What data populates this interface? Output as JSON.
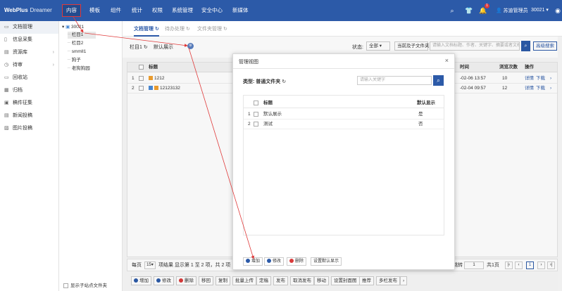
{
  "app": {
    "brand": "WebPlus",
    "brand_sub": "Dreamer"
  },
  "nav": {
    "items": [
      {
        "label": "内容",
        "active": true
      },
      {
        "label": "模板"
      },
      {
        "label": "组件"
      },
      {
        "label": "统计"
      },
      {
        "label": "权限"
      },
      {
        "label": "系统管理"
      },
      {
        "label": "安全中心"
      },
      {
        "label": "新媒体"
      }
    ],
    "notification_count": "1",
    "user": "苏迪管理员",
    "site": "30021"
  },
  "sidebar": {
    "items": [
      {
        "label": "文档管理",
        "icon": "folder-icon",
        "active": true
      },
      {
        "label": "信息采集",
        "icon": "file-icon"
      },
      {
        "label": "资源库",
        "icon": "database-icon",
        "arrow": true
      },
      {
        "label": "待审",
        "icon": "clock-icon",
        "arrow": true
      },
      {
        "label": "回收站",
        "icon": "trash-icon"
      },
      {
        "label": "归档",
        "icon": "archive-icon"
      },
      {
        "label": "稿件征集",
        "icon": "collect-icon"
      },
      {
        "label": "新闻投稿",
        "icon": "news-icon"
      },
      {
        "label": "图片投稿",
        "icon": "image-icon"
      }
    ]
  },
  "tree": {
    "root": "30021",
    "nodes": [
      "栏目1",
      "栏目2",
      "smmll1",
      "狗子",
      "老狗狗园"
    ],
    "footer": "显示子站点文件夹"
  },
  "tabs": [
    {
      "label": "文档管理",
      "active": true
    },
    {
      "label": "待办处理"
    },
    {
      "label": "文件夹管理"
    }
  ],
  "toolbar": {
    "crumb": "栏目1",
    "view_label": "默认展示",
    "status_label": "状态:",
    "status_value": "全部",
    "scope_value": "当前及子文件夹",
    "search_placeholder": "请输入文档标题、作者、关键字、摘要或者文档内容",
    "advanced_search": "高级搜索"
  },
  "grid": {
    "headers": {
      "title": "标题",
      "time": "时间",
      "views": "浏览次数",
      "ops": "操作"
    },
    "rows": [
      {
        "no": "1",
        "title": "1212",
        "time": "-02-06 13:57",
        "views": "10",
        "op1": "详情",
        "op2": "下载"
      },
      {
        "no": "2",
        "title": "12123132",
        "time": "-02-04 09:57",
        "views": "12",
        "op1": "详情",
        "op2": "下载"
      }
    ]
  },
  "pager": {
    "per_page_label": "每页",
    "per_page_value": "15",
    "summary": "项结果 显示第 1 至 2 项，共 2 项",
    "goto_label": "跳转",
    "goto_value": "1",
    "total_pages": "共1页",
    "current_page": "1"
  },
  "actions": [
    {
      "label": "增加",
      "dot": "b"
    },
    {
      "label": "修改",
      "dot": "b"
    },
    {
      "label": "删除",
      "dot": "r"
    },
    {
      "label": "移回"
    },
    {
      "label": "复制"
    },
    {
      "label": "批量上传"
    },
    {
      "label": "定稿"
    },
    {
      "label": "发布"
    },
    {
      "label": "取消发布"
    },
    {
      "label": "移动"
    },
    {
      "label": "设置封面图"
    },
    {
      "label": "推荐"
    },
    {
      "label": "多栏发布"
    }
  ],
  "modal": {
    "title": "管理视图",
    "type_label": "类型:",
    "type_value": "普通文件夹",
    "search_placeholder": "请输入关键字",
    "headers": {
      "title": "标题",
      "default": "默认显示"
    },
    "rows": [
      {
        "no": "1",
        "title": "默认展示",
        "default": "是"
      },
      {
        "no": "2",
        "title": "测试",
        "default": "否"
      }
    ],
    "buttons": [
      {
        "label": "增加",
        "dot": "b"
      },
      {
        "label": "修改",
        "dot": "b"
      },
      {
        "label": "删除",
        "dot": "r"
      },
      {
        "label": "设置默认显示"
      }
    ]
  },
  "colors": {
    "primary": "#2c5aa8",
    "annotation": "#e03a3a"
  }
}
